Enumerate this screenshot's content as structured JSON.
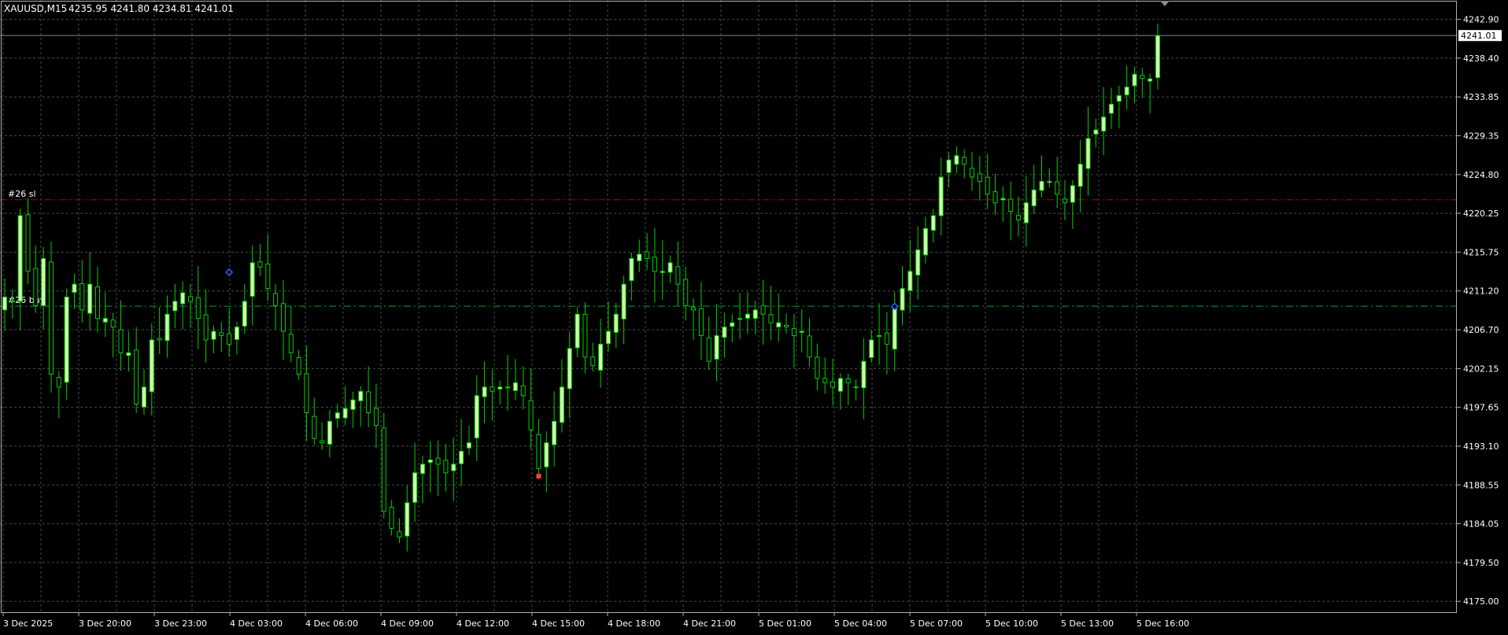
{
  "header": {
    "symbol_timeframe": "XAUUSD,M15",
    "ohlc": "4235.95 4241.80 4234.81 4241.01"
  },
  "colors": {
    "background": "#000000",
    "grid": "#4a4a4a",
    "frame": "#b0b0b0",
    "text": "#ffffff",
    "bull_body": "#d4fcb0",
    "bear_body": "#000000",
    "candle_wick": "#00d000",
    "bid_line": "#778899",
    "sl_line": "#c00000",
    "entry_line": "#00a040",
    "trade_marker": "#3060ff"
  },
  "order_lines": [
    {
      "label": "#26 sl",
      "price": 4221.85,
      "color": "#c00000"
    },
    {
      "label": "#26 buy",
      "price": 4209.44,
      "color": "#00a040"
    }
  ],
  "price_scale": {
    "current_price": "4241.01",
    "labels": [
      "4242.90",
      "4238.40",
      "4233.85",
      "4229.35",
      "4224.80",
      "4220.25",
      "4215.75",
      "4211.20",
      "4206.70",
      "4202.15",
      "4197.65",
      "4193.10",
      "4188.55",
      "4184.05",
      "4179.50",
      "4175.00"
    ]
  },
  "time_scale": {
    "labels": [
      "3 Dec 2025",
      "3 Dec 20:00",
      "3 Dec 23:00",
      "4 Dec 03:00",
      "4 Dec 06:00",
      "4 Dec 09:00",
      "4 Dec 12:00",
      "4 Dec 15:00",
      "4 Dec 18:00",
      "4 Dec 21:00",
      "5 Dec 01:00",
      "5 Dec 04:00",
      "5 Dec 07:00",
      "5 Dec 10:00",
      "5 Dec 13:00",
      "5 Dec 16:00"
    ]
  },
  "chart_data": {
    "type": "candlestick",
    "symbol": "XAUUSD",
    "timeframe": "M15",
    "ylim": [
      4173.5,
      4244.6
    ],
    "grid": true,
    "candle_count": 150,
    "trade_markers": [
      {
        "candle": 29,
        "price": 4213.4,
        "type": "buy-entry"
      },
      {
        "candle": 69,
        "price": 4189.6,
        "type": "exit"
      },
      {
        "candle": 115,
        "price": 4209.4,
        "type": "buy-entry"
      }
    ],
    "closes": [
      4210.5,
      4210.0,
      4220.0,
      4213.5,
      4209.5,
      4215.0,
      4201.5,
      4200.0,
      4210.5,
      4212.0,
      4209.0,
      4212.0,
      4208.0,
      4208.0,
      4207.0,
      4204.0,
      4204.0,
      4198.0,
      4200.0,
      4205.5,
      4205.5,
      4208.5,
      4210.0,
      4211.0,
      4210.0,
      4208.0,
      4205.5,
      4206.5,
      4206.0,
      4205.0,
      4207.0,
      4210.0,
      4214.5,
      4214.0,
      4211.5,
      4209.5,
      4206.5,
      4204.0,
      4201.5,
      4197.0,
      4194.0,
      4193.5,
      4196.0,
      4197.0,
      4197.5,
      4198.5,
      4199.5,
      4197.0,
      4195.5,
      4185.5,
      4183.5,
      4182.5,
      4186.5,
      4190.0,
      4191.0,
      4191.5,
      4191.0,
      4190.0,
      4191.0,
      4192.5,
      4193.5,
      4199.0,
      4200.0,
      4199.5,
      4200.0,
      4200.0,
      4200.5,
      4199.0,
      4195.0,
      4190.5,
      4193.5,
      4196.0,
      4200.0,
      4204.5,
      4208.5,
      4203.5,
      4202.5,
      4205.0,
      4206.5,
      4208.5,
      4212.0,
      4215.0,
      4215.5,
      4215.0,
      4213.5,
      4213.5,
      4214.5,
      4212.0,
      4209.5,
      4209.0,
      4206.0,
      4203.0,
      4206.0,
      4207.0,
      4207.5,
      4208.0,
      4208.5,
      4209.0,
      4208.5,
      4207.5,
      4207.5,
      4207.0,
      4206.0,
      4206.5,
      4203.5,
      4201.0,
      4200.5,
      4200.0,
      4201.0,
      4200.5,
      4200.0,
      4203.0,
      4205.5,
      4206.0,
      4205.0,
      4209.5,
      4211.5,
      4213.5,
      4216.0,
      4218.5,
      4220.0,
      4224.5,
      4226.5,
      4227.0,
      4226.0,
      4224.5,
      4224.0,
      4222.5,
      4221.5,
      4222.0,
      4220.5,
      4219.5,
      4221.5,
      4223.0,
      4224.0,
      4224.0,
      4222.5,
      4221.5,
      4223.5,
      4226.0,
      4229.0,
      4230.0,
      4231.5,
      4233.0,
      4234.0,
      4235.0,
      4236.5,
      4236.0,
      4235.95,
      4241.01
    ]
  }
}
